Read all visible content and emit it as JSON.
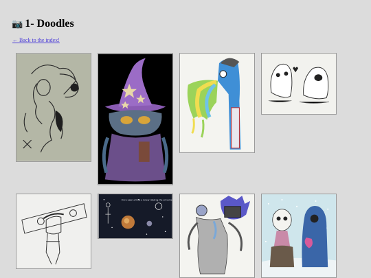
{
  "page": {
    "title_icon": "camera-icon",
    "title": "1- Doodles",
    "back_link": "← Back to the index!"
  },
  "gallery": {
    "items": [
      {
        "subject": "hooded-figure-sketch"
      },
      {
        "subject": "wizard-doodle"
      },
      {
        "subject": "blue-creature-rainbow-vomit"
      },
      {
        "subject": "two-ghosts-heart"
      },
      {
        "subject": "pillory-prisoner-sketch"
      },
      {
        "subject": "space-scene"
      },
      {
        "subject": "robot-creature"
      },
      {
        "subject": "two-monsters-snow"
      }
    ],
    "space_note": "Once upon a time a lonely robot in the universe"
  },
  "colors": {
    "background": "#dcdcdc",
    "link": "#4a3ad8",
    "wizard_hat": "#8a5bb3",
    "creature_blue": "#3f8fd6"
  }
}
